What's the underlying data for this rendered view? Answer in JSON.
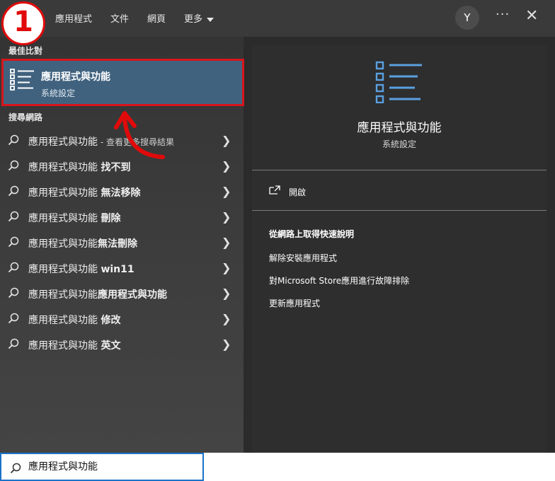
{
  "tabs": {
    "apps": "應用程式",
    "documents": "文件",
    "web": "網頁",
    "more": "更多"
  },
  "user": {
    "initial": "Y"
  },
  "menu": {
    "more_dots": "···",
    "close": "✕"
  },
  "annotation": {
    "step": "1"
  },
  "best_match": {
    "section_title": "最佳比對",
    "title": "應用程式與功能",
    "subtitle": "系統設定"
  },
  "web_search": {
    "section_title": "搜尋網路",
    "items": [
      {
        "main": "應用程式與功能",
        "bold": "",
        "suffix": " - 查看更多搜尋結果"
      },
      {
        "main": "應用程式與功能 ",
        "bold": "找不到",
        "suffix": ""
      },
      {
        "main": "應用程式與功能 ",
        "bold": "無法移除",
        "suffix": ""
      },
      {
        "main": "應用程式與功能 ",
        "bold": "刪除",
        "suffix": ""
      },
      {
        "main": "應用程式與功能",
        "bold": "無法刪除",
        "suffix": ""
      },
      {
        "main": "應用程式與功能 ",
        "bold": "win11",
        "suffix": ""
      },
      {
        "main": "應用程式與功能",
        "bold": "應用程式與功能",
        "suffix": ""
      },
      {
        "main": "應用程式與功能 ",
        "bold": "修改",
        "suffix": ""
      },
      {
        "main": "應用程式與功能 ",
        "bold": "英文",
        "suffix": ""
      }
    ]
  },
  "detail": {
    "title": "應用程式與功能",
    "subtitle": "系統設定",
    "open_label": "開啟",
    "web_help_title": "從網路上取得快速說明",
    "links": [
      "解除安裝應用程式",
      "對Microsoft Store應用進行故障排除",
      "更新應用程式"
    ]
  },
  "search": {
    "value": "應用程式與功能"
  },
  "colors": {
    "accent": "#40627f",
    "highlight_red": "#d8151b",
    "icon_blue": "#5aa0e0",
    "focus_blue": "#1a73c9"
  }
}
